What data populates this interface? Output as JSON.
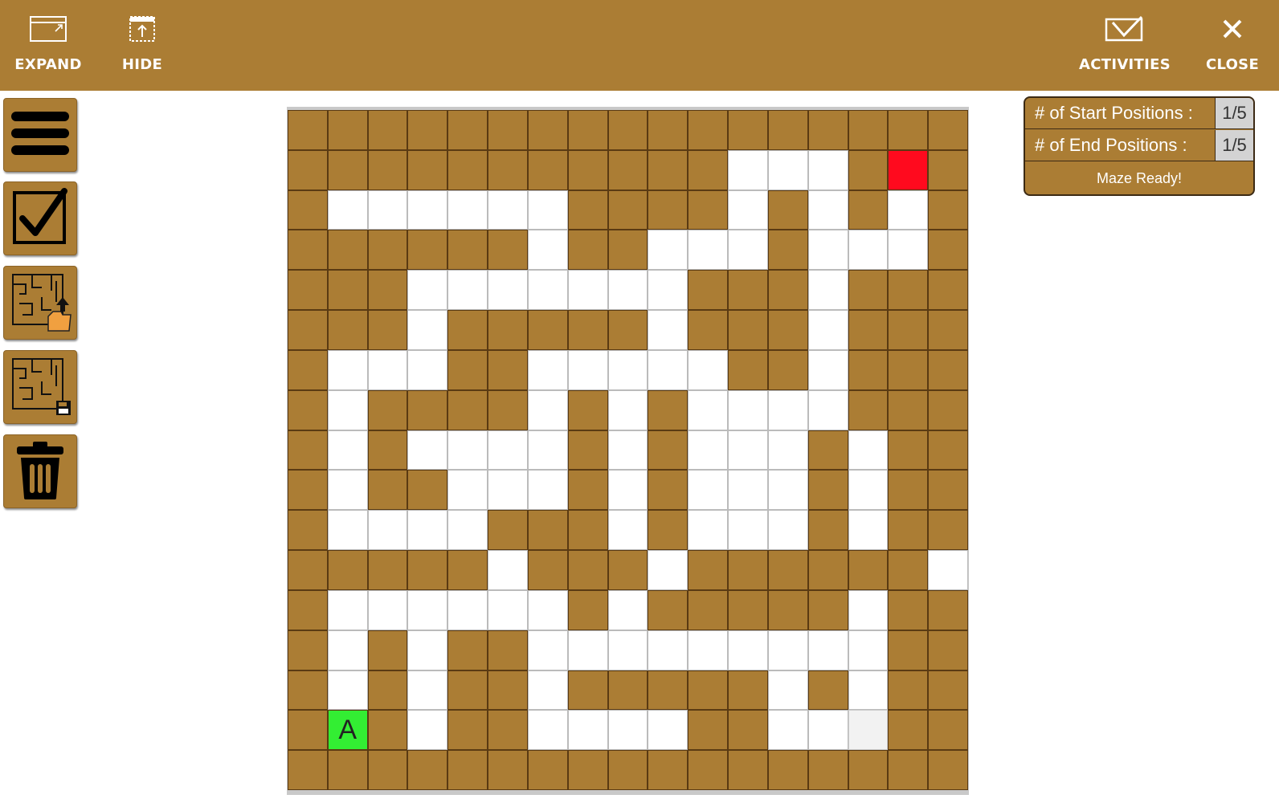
{
  "toolbar": {
    "expand": "EXPAND",
    "hide": "HIDE",
    "activities": "ACTIVITIES",
    "close": "CLOSE"
  },
  "sidebar": [
    "menu-icon",
    "check-icon",
    "load-maze-icon",
    "save-maze-icon",
    "trash-icon"
  ],
  "info": {
    "start_label": "# of Start Positions :",
    "start_value": "1/5",
    "end_label": "# of End Positions :",
    "end_value": "1/5",
    "status": "Maze Ready!"
  },
  "maze": {
    "start_marker": "A",
    "rows": [
      "#################",
      "###########...#E#",
      "#......####.#.#.#",
      "######.##...#...#",
      "###.......###.###",
      "###.#####.###.###",
      "#...##.....##.###",
      "#.####.#.#....###",
      "#.#....#.#...#.##",
      "#.##...#.#...#.##",
      "#....###.#...#.##",
      "#####.###.######.##",
      "#......#.#####.##",
      "#.#.##.........##",
      "#.#.##.#####.#.##",
      "#S#.##....##..H##",
      "#################"
    ],
    "colors": {
      "wall": "#ab7d34",
      "open": "#ffffff",
      "start": "#33ee33",
      "end": "#ff0a1e"
    }
  }
}
